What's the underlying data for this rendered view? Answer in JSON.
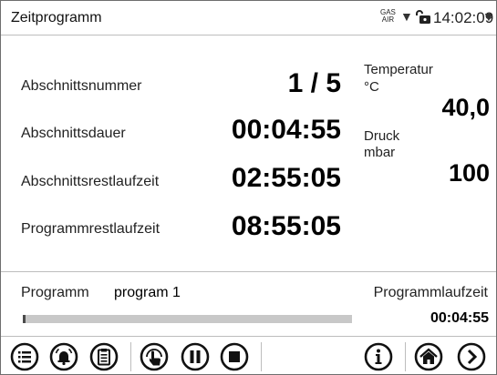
{
  "header": {
    "title": "Zeitprogramm",
    "gas_line1": "GAS",
    "gas_line2": "AIR",
    "time": "14:02:09"
  },
  "main": {
    "segment_number_label": "Abschnittsnummer",
    "segment_number_value": "1 / 5",
    "segment_duration_label": "Abschnittsdauer",
    "segment_duration_value": "00:04:55",
    "segment_remaining_label": "Abschnittsrestlaufzeit",
    "segment_remaining_value": "02:55:05",
    "program_remaining_label": "Programmrestlaufzeit",
    "program_remaining_value": "08:55:05",
    "temperature_label": "Temperatur",
    "temperature_unit": "°C",
    "temperature_value": "40,0",
    "pressure_label": "Druck",
    "pressure_unit": "mbar",
    "pressure_value": "100"
  },
  "footer": {
    "program_label": "Programm",
    "program_name": "program 1",
    "runtime_label": "Programmlaufzeit",
    "runtime_value": "00:04:55",
    "progress_fraction": 0.008
  },
  "toolbar": {
    "icons": [
      "menu-icon",
      "alarm-icon",
      "clipboard-icon",
      "touch-icon",
      "pause-icon",
      "stop-icon",
      "info-icon",
      "home-icon",
      "next-icon"
    ]
  }
}
